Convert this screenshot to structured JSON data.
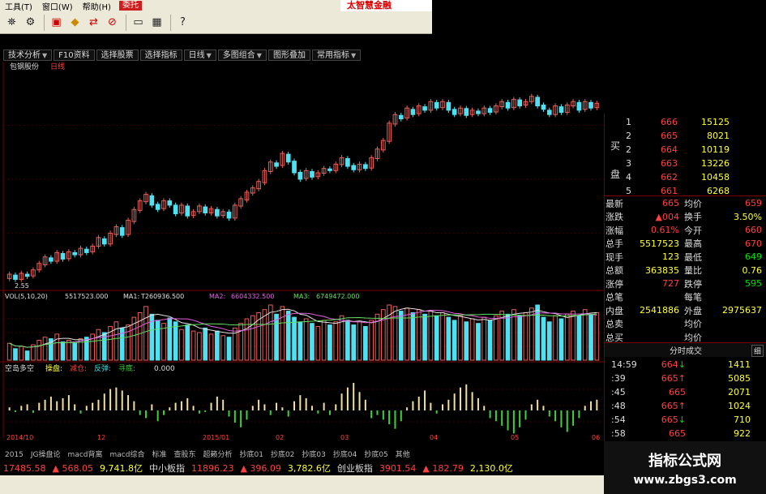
{
  "menu": [
    "工具(T)",
    "窗口(W)",
    "帮助(H)"
  ],
  "entrust_label": "委托",
  "brand": "太智慧金融",
  "func_tabs": [
    {
      "label": "技术分析",
      "dropdown": true
    },
    {
      "label": "F10资料",
      "dropdown": false
    },
    {
      "label": "选择股票",
      "dropdown": false
    },
    {
      "label": "选择指标",
      "dropdown": false
    },
    {
      "label": "日线",
      "dropdown": true
    },
    {
      "label": "多图组合",
      "dropdown": true
    },
    {
      "label": "图形叠加",
      "dropdown": false
    },
    {
      "label": "常用指标",
      "dropdown": true
    }
  ],
  "chart": {
    "stock_name": "包钢股份",
    "period": "日线",
    "low_mark": "2.55",
    "vol_line": "VOL(5,10,20)",
    "vol_value": "5517523.000",
    "ma1_label": "MA1:",
    "ma1_value": "T260936.500",
    "ma2_label": "MA2:",
    "ma2_value": "6604332.500",
    "ma3_label": "MA3:",
    "ma3_value": "6749472.000",
    "ind_name": "空岛多空",
    "ind_labels": [
      "操盘:",
      "减仓:",
      "反弹:",
      "寻底:"
    ],
    "ind_value": "0.000",
    "date_labels": [
      "2014/10",
      "12",
      "2015/01",
      "02",
      "03",
      "04",
      "05",
      "06"
    ],
    "colors": {
      "up": "#e8605a",
      "down": "#50e0f0",
      "ma1": "#e0e0e0",
      "ma2": "#e060e0",
      "ma3": "#60e060",
      "ind_up": "#f0e0a0",
      "ind_down": "#40d040",
      "grid": "#7a0000"
    }
  },
  "orderbook": {
    "buy_side_label": [
      "买",
      "盘"
    ],
    "rows": [
      {
        "level": "1",
        "price": "666",
        "vol": "15125"
      },
      {
        "level": "2",
        "price": "665",
        "vol": "8021"
      },
      {
        "level": "2",
        "price": "664",
        "vol": "10119"
      },
      {
        "level": "3",
        "price": "663",
        "vol": "13226"
      },
      {
        "level": "4",
        "price": "662",
        "vol": "10458"
      },
      {
        "level": "5",
        "price": "661",
        "vol": "6268"
      }
    ]
  },
  "quote_kv": [
    {
      "k": "最新",
      "v": "665",
      "vc": "red",
      "k2": "均价",
      "v2": "659",
      "v2c": "red"
    },
    {
      "k": "涨跌",
      "v": "▲004",
      "vc": "red",
      "k2": "换手",
      "v2": "3.50%",
      "v2c": "yellow"
    },
    {
      "k": "涨幅",
      "v": "0.61%",
      "vc": "red",
      "k2": "今开",
      "v2": "660",
      "v2c": "red"
    },
    {
      "k": "总手",
      "v": "5517523",
      "vc": "yellow",
      "k2": "最高",
      "v2": "670",
      "v2c": "red"
    },
    {
      "k": "现手",
      "v": "123",
      "vc": "yellow",
      "k2": "最低",
      "v2": "649",
      "v2c": "green"
    },
    {
      "k": "总额",
      "v": "363835",
      "vc": "yellow",
      "k2": "量比",
      "v2": "0.76",
      "v2c": "yellow"
    },
    {
      "k": "涨停",
      "v": "727",
      "vc": "red",
      "k2": "跌停",
      "v2": "595",
      "v2c": "green"
    },
    {
      "k": "总笔",
      "v": "",
      "vc": "white",
      "k2": "每笔",
      "v2": "",
      "v2c": "white"
    },
    {
      "k": "内盘",
      "v": "2541886",
      "vc": "yellow",
      "k2": "外盘",
      "v2": "2975637",
      "v2c": "yellow"
    },
    {
      "k": "总卖",
      "v": "",
      "vc": "white",
      "k2": "均价",
      "v2": "",
      "v2c": "white"
    },
    {
      "k": "总买",
      "v": "",
      "vc": "white",
      "k2": "均价",
      "v2": "",
      "v2c": "white"
    }
  ],
  "ticks_header": "分时成交",
  "ticks_button": "细",
  "ticks": [
    {
      "t": "14:59",
      "p": "664",
      "dir": "down",
      "q": "1411"
    },
    {
      "t": ":39",
      "p": "665",
      "dir": "up",
      "q": "5085"
    },
    {
      "t": ":45",
      "p": "665",
      "dir": "",
      "q": "2071"
    },
    {
      "t": ":48",
      "p": "665",
      "dir": "up",
      "q": "1024"
    },
    {
      "t": ":54",
      "p": "665",
      "dir": "down",
      "q": "710"
    },
    {
      "t": ":58",
      "p": "665",
      "dir": "",
      "q": "922"
    },
    {
      "t": "15:00",
      "p": "",
      "dir": "",
      "q": ""
    }
  ],
  "bottom_tabs": [
    "2015",
    "JG操盘论",
    "macd背离",
    "macd综合",
    "标准",
    "查股东",
    "超籁分析",
    "抄底01",
    "抄底02",
    "抄底03",
    "抄底04",
    "抄底05",
    "其他"
  ],
  "index_bar": [
    {
      "text": "17485.58",
      "c": "red"
    },
    {
      "text": "▲ 568.05",
      "c": "red"
    },
    {
      "text": "9,741.8亿",
      "c": "yellow"
    },
    {
      "text": "中小板指",
      "c": "white"
    },
    {
      "text": "11896.23",
      "c": "red"
    },
    {
      "text": "▲ 396.09",
      "c": "red"
    },
    {
      "text": "3,782.6亿",
      "c": "yellow"
    },
    {
      "text": "创业板指",
      "c": "white"
    },
    {
      "text": "3901.54",
      "c": "red"
    },
    {
      "text": "▲ 182.79",
      "c": "red"
    },
    {
      "text": "2,130.0亿",
      "c": "yellow"
    }
  ],
  "watermark": {
    "line1": "指标公式网",
    "line2": "www.zbgs3.com"
  },
  "chart_data": {
    "type": "candlestick",
    "price_range": [
      2.4,
      7.4
    ],
    "candles": [
      [
        2.6,
        2.7
      ],
      [
        2.68,
        2.58
      ],
      [
        2.58,
        2.72
      ],
      [
        2.7,
        2.65
      ],
      [
        2.66,
        2.8
      ],
      [
        2.8,
        2.95
      ],
      [
        2.92,
        3.1
      ],
      [
        3.08,
        3.0
      ],
      [
        3.0,
        3.2
      ],
      [
        3.18,
        3.05
      ],
      [
        3.06,
        3.22
      ],
      [
        3.2,
        3.15
      ],
      [
        3.15,
        3.3
      ],
      [
        3.28,
        3.2
      ],
      [
        3.22,
        3.35
      ],
      [
        3.35,
        3.55
      ],
      [
        3.52,
        3.4
      ],
      [
        3.4,
        3.65
      ],
      [
        3.62,
        3.8
      ],
      [
        3.78,
        3.6
      ],
      [
        3.62,
        3.95
      ],
      [
        3.92,
        4.2
      ],
      [
        4.18,
        4.4
      ],
      [
        4.38,
        4.55
      ],
      [
        4.52,
        4.3
      ],
      [
        4.32,
        4.2
      ],
      [
        4.22,
        4.4
      ],
      [
        4.4,
        4.3
      ],
      [
        4.3,
        4.1
      ],
      [
        4.12,
        4.3
      ],
      [
        4.28,
        4.05
      ],
      [
        4.06,
        4.15
      ],
      [
        4.15,
        4.28
      ],
      [
        4.26,
        4.12
      ],
      [
        4.12,
        4.22
      ],
      [
        4.2,
        4.05
      ],
      [
        4.06,
        4.15
      ],
      [
        4.14,
        4.0
      ],
      [
        4.0,
        4.3
      ],
      [
        4.28,
        4.45
      ],
      [
        4.42,
        4.6
      ],
      [
        4.58,
        4.7
      ],
      [
        4.68,
        4.85
      ],
      [
        4.82,
        5.1
      ],
      [
        5.08,
        5.3
      ],
      [
        5.28,
        5.2
      ],
      [
        5.22,
        5.5
      ],
      [
        5.48,
        5.3
      ],
      [
        5.32,
        5.05
      ],
      [
        5.06,
        4.9
      ],
      [
        4.92,
        5.1
      ],
      [
        5.08,
        4.95
      ],
      [
        4.96,
        5.05
      ],
      [
        5.04,
        5.15
      ],
      [
        5.14,
        5.1
      ],
      [
        5.1,
        5.25
      ],
      [
        5.24,
        5.4
      ],
      [
        5.38,
        5.2
      ],
      [
        5.22,
        5.12
      ],
      [
        5.12,
        5.25
      ],
      [
        5.24,
        5.15
      ],
      [
        5.16,
        5.4
      ],
      [
        5.38,
        5.6
      ],
      [
        5.58,
        5.8
      ],
      [
        5.78,
        6.2
      ],
      [
        6.18,
        6.4
      ],
      [
        6.38,
        6.3
      ],
      [
        6.32,
        6.55
      ],
      [
        6.52,
        6.4
      ],
      [
        6.42,
        6.6
      ],
      [
        6.58,
        6.5
      ],
      [
        6.5,
        6.7
      ],
      [
        6.68,
        6.55
      ],
      [
        6.56,
        6.7
      ],
      [
        6.68,
        6.5
      ],
      [
        6.52,
        6.4
      ],
      [
        6.42,
        6.55
      ],
      [
        6.54,
        6.38
      ],
      [
        6.4,
        6.5
      ],
      [
        6.48,
        6.42
      ],
      [
        6.42,
        6.55
      ],
      [
        6.54,
        6.45
      ],
      [
        6.46,
        6.6
      ],
      [
        6.58,
        6.7
      ],
      [
        6.68,
        6.55
      ],
      [
        6.56,
        6.75
      ],
      [
        6.74,
        6.6
      ],
      [
        6.62,
        6.7
      ],
      [
        6.7,
        6.82
      ],
      [
        6.8,
        6.6
      ],
      [
        6.62,
        6.52
      ],
      [
        6.5,
        6.4
      ],
      [
        6.4,
        6.6
      ],
      [
        6.58,
        6.45
      ],
      [
        6.45,
        6.62
      ],
      [
        6.6,
        6.7
      ],
      [
        6.68,
        6.5
      ],
      [
        6.52,
        6.7
      ],
      [
        6.68,
        6.55
      ],
      [
        6.56,
        6.66
      ]
    ],
    "volume": [
      22,
      15,
      18,
      12,
      20,
      26,
      30,
      28,
      34,
      24,
      26,
      22,
      28,
      30,
      34,
      40,
      36,
      44,
      50,
      42,
      46,
      56,
      62,
      70,
      60,
      52,
      48,
      55,
      50,
      40,
      46,
      38,
      36,
      42,
      34,
      38,
      32,
      30,
      42,
      48,
      54,
      58,
      62,
      66,
      72,
      60,
      70,
      64,
      56,
      50,
      54,
      48,
      44,
      52,
      46,
      50,
      58,
      52,
      46,
      50,
      44,
      52,
      60,
      66,
      72,
      70,
      64,
      68,
      62,
      66,
      60,
      64,
      58,
      62,
      56,
      52,
      58,
      50,
      54,
      48,
      56,
      52,
      58,
      64,
      60,
      66,
      58,
      62,
      68,
      72,
      56,
      50,
      58,
      54,
      60,
      64,
      58,
      66,
      60,
      62
    ],
    "indicator": [
      4,
      -2,
      6,
      8,
      -3,
      10,
      14,
      18,
      12,
      16,
      20,
      8,
      -4,
      6,
      10,
      14,
      22,
      28,
      30,
      26,
      20,
      12,
      -6,
      -10,
      8,
      -14,
      -6,
      4,
      10,
      12,
      16,
      6,
      -4,
      -2,
      10,
      18,
      14,
      -8,
      -16,
      -22,
      -12,
      6,
      14,
      8,
      -6,
      10,
      4,
      -8,
      12,
      20,
      16,
      6,
      -4,
      10,
      -6,
      8,
      22,
      30,
      36,
      24,
      14,
      -10,
      -6,
      -12,
      -18,
      -24,
      -14,
      4,
      12,
      18,
      26,
      10,
      -4,
      8,
      14,
      22,
      30,
      34,
      24,
      16,
      6,
      -10,
      -14,
      -20,
      -26,
      -30,
      -22,
      -12,
      8,
      14,
      6,
      -8,
      -14,
      -22,
      -28,
      -20,
      -10,
      6,
      12,
      14
    ]
  }
}
